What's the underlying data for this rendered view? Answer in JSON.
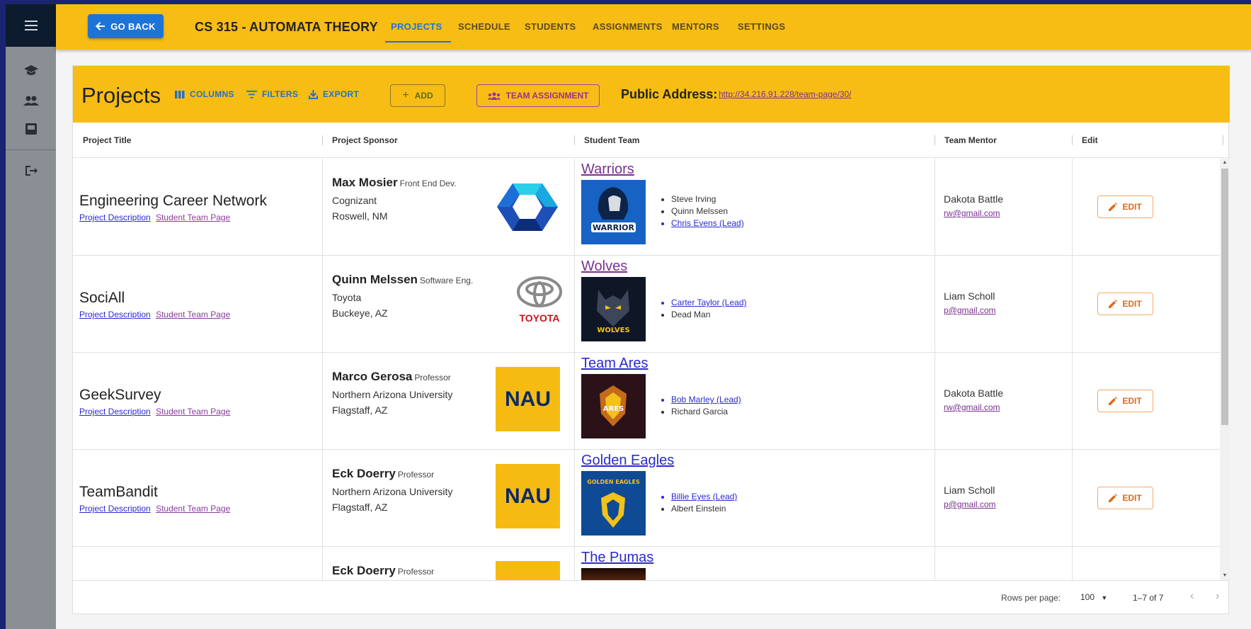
{
  "nav": {
    "go_back": "GO BACK",
    "course_title": "CS 315 - AUTOMATA THEORY",
    "tabs": [
      "PROJECTS",
      "SCHEDULE",
      "STUDENTS",
      "ASSIGNMENTS",
      "MENTORS",
      "SETTINGS"
    ],
    "active_tab": "PROJECTS"
  },
  "toolbar": {
    "title": "Projects",
    "columns": "COLUMNS",
    "filters": "FILTERS",
    "export": "EXPORT",
    "add": "ADD",
    "team_assignment": "TEAM ASSIGNMENT",
    "public_address_label": "Public Address:",
    "public_address_url": "http://34.216.91.228/team-page/30/"
  },
  "table": {
    "headers": [
      "Project Title",
      "Project Sponsor",
      "Student Team",
      "Team Mentor",
      "Edit"
    ],
    "link_desc": "Project Description",
    "link_page": "Student Team Page",
    "edit_label": "EDIT",
    "rows": [
      {
        "title": "Engineering Career Network",
        "sponsor_name": "Max Mosier",
        "sponsor_role": "Front End Dev.",
        "company": "Cognizant",
        "location": "Roswell, NM",
        "team": "Warriors",
        "members": [
          "Steve Irving",
          "Quinn Melssen",
          "Chris Evens (Lead)"
        ],
        "mentor": "Dakota Battle",
        "mentor_email": "rw@gmail.com"
      },
      {
        "title": "SociAll",
        "sponsor_name": "Quinn Melssen",
        "sponsor_role": "Software Eng.",
        "company": "Toyota",
        "location": "Buckeye, AZ",
        "team": "Wolves",
        "members": [
          "Carter Taylor (Lead)",
          "Dead Man"
        ],
        "mentor": "Liam Scholl",
        "mentor_email": "p@gmail.com"
      },
      {
        "title": "GeekSurvey",
        "sponsor_name": "Marco Gerosa",
        "sponsor_role": "Professor",
        "company": "Northern Arizona University",
        "location": "Flagstaff, AZ",
        "team": "Team Ares",
        "members": [
          "Bob Marley (Lead)",
          "Richard Garcia"
        ],
        "mentor": "Dakota Battle",
        "mentor_email": "rw@gmail.com"
      },
      {
        "title": "TeamBandit",
        "sponsor_name": "Eck Doerry",
        "sponsor_role": "Professor",
        "company": "Northern Arizona University",
        "location": "Flagstaff, AZ",
        "team": "Golden Eagles",
        "members": [
          "Billie Eyes (Lead)",
          "Albert Einstein"
        ],
        "mentor": "Liam Scholl",
        "mentor_email": "p@gmail.com"
      },
      {
        "title": "",
        "sponsor_name": "Eck Doerry",
        "sponsor_role": "Professor",
        "company": "",
        "location": "",
        "team": "The Pumas",
        "members": [],
        "mentor": "",
        "mentor_email": ""
      }
    ]
  },
  "logos": {
    "toyota": "TOYOTA",
    "nau": "NAU",
    "warrior": "WARRIOR",
    "wolves": "WOLVES",
    "ares": "ARES",
    "golden_eagles": "GOLDEN EAGLES"
  },
  "footer": {
    "rows_per_page_label": "Rows per page:",
    "rows_per_page_value": "100",
    "page_range": "1–7 of 7"
  },
  "colors": {
    "header_yellow": "#f7bd15",
    "primary_blue": "#1e74d6",
    "rail_dark": "#0d1b2e"
  }
}
